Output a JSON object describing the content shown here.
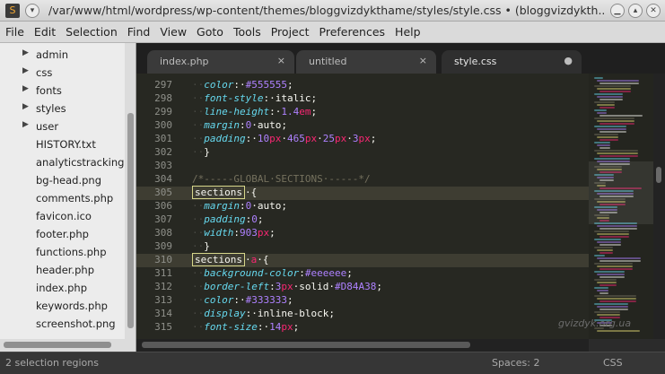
{
  "window": {
    "title": "/var/www/html/wordpress/wp-content/themes/bloggvizdykthame/styles/style.css • (bloggvizdykth..."
  },
  "menu": [
    "File",
    "Edit",
    "Selection",
    "Find",
    "View",
    "Goto",
    "Tools",
    "Project",
    "Preferences",
    "Help"
  ],
  "sidebar": {
    "items": [
      {
        "label": "admin",
        "folder": true
      },
      {
        "label": "css",
        "folder": true
      },
      {
        "label": "fonts",
        "folder": true
      },
      {
        "label": "styles",
        "folder": true
      },
      {
        "label": "user",
        "folder": true
      },
      {
        "label": "HISTORY.txt",
        "folder": false
      },
      {
        "label": "analyticstracking",
        "folder": false
      },
      {
        "label": "bg-head.png",
        "folder": false
      },
      {
        "label": "comments.php",
        "folder": false
      },
      {
        "label": "favicon.ico",
        "folder": false
      },
      {
        "label": "footer.php",
        "folder": false
      },
      {
        "label": "functions.php",
        "folder": false
      },
      {
        "label": "header.php",
        "folder": false
      },
      {
        "label": "index.php",
        "folder": false
      },
      {
        "label": "keywords.php",
        "folder": false
      },
      {
        "label": "screenshot.png",
        "folder": false
      }
    ]
  },
  "tabs": [
    {
      "label": "index.php",
      "close": "×",
      "active": false
    },
    {
      "label": "untitled",
      "close": "×",
      "active": false
    },
    {
      "label": "style.css",
      "close": "●",
      "active": true
    }
  ],
  "editor": {
    "highlight_lines": [
      "305",
      "310"
    ],
    "lines": [
      {
        "num": "297",
        "segs": [
          [
            "ws",
            "··"
          ],
          [
            "prop",
            "color"
          ],
          [
            "plain",
            ":·"
          ],
          [
            "val",
            "#555555"
          ],
          [
            "plain",
            ";"
          ]
        ]
      },
      {
        "num": "298",
        "segs": [
          [
            "ws",
            "··"
          ],
          [
            "prop",
            "font-style"
          ],
          [
            "plain",
            ":·italic;"
          ]
        ]
      },
      {
        "num": "299",
        "segs": [
          [
            "ws",
            "··"
          ],
          [
            "prop",
            "line-height"
          ],
          [
            "plain",
            ":·"
          ],
          [
            "val",
            "1.4"
          ],
          [
            "unit",
            "em"
          ],
          [
            "plain",
            ";"
          ]
        ]
      },
      {
        "num": "300",
        "segs": [
          [
            "ws",
            "··"
          ],
          [
            "prop",
            "margin"
          ],
          [
            "plain",
            ":"
          ],
          [
            "val",
            "0"
          ],
          [
            "plain",
            "·auto;"
          ]
        ]
      },
      {
        "num": "301",
        "segs": [
          [
            "ws",
            "··"
          ],
          [
            "prop",
            "padding"
          ],
          [
            "plain",
            ":·"
          ],
          [
            "val",
            "10"
          ],
          [
            "unit",
            "px"
          ],
          [
            "plain",
            "·"
          ],
          [
            "val",
            "465"
          ],
          [
            "unit",
            "px"
          ],
          [
            "plain",
            "·"
          ],
          [
            "val",
            "25"
          ],
          [
            "unit",
            "px"
          ],
          [
            "plain",
            "·"
          ],
          [
            "val",
            "3"
          ],
          [
            "unit",
            "px"
          ],
          [
            "plain",
            ";"
          ]
        ]
      },
      {
        "num": "302",
        "segs": [
          [
            "ws",
            "··"
          ],
          [
            "plain",
            "}"
          ]
        ]
      },
      {
        "num": "303",
        "segs": []
      },
      {
        "num": "304",
        "segs": [
          [
            "cmt",
            "/*-----GLOBAL·SECTIONS·-----*/"
          ]
        ]
      },
      {
        "num": "305",
        "segs": [
          [
            "sel",
            "sections"
          ],
          [
            "plain",
            "·{"
          ]
        ]
      },
      {
        "num": "306",
        "segs": [
          [
            "ws",
            "··"
          ],
          [
            "prop",
            "margin"
          ],
          [
            "plain",
            ":"
          ],
          [
            "val",
            "0"
          ],
          [
            "plain",
            "·auto;"
          ]
        ]
      },
      {
        "num": "307",
        "segs": [
          [
            "ws",
            "··"
          ],
          [
            "prop",
            "padding"
          ],
          [
            "plain",
            ":"
          ],
          [
            "val",
            "0"
          ],
          [
            "plain",
            ";"
          ]
        ]
      },
      {
        "num": "308",
        "segs": [
          [
            "ws",
            "··"
          ],
          [
            "prop",
            "width"
          ],
          [
            "plain",
            ":"
          ],
          [
            "val",
            "903"
          ],
          [
            "unit",
            "px"
          ],
          [
            "plain",
            ";"
          ]
        ]
      },
      {
        "num": "309",
        "segs": [
          [
            "ws",
            "··"
          ],
          [
            "plain",
            "}"
          ]
        ]
      },
      {
        "num": "310",
        "segs": [
          [
            "sel",
            "sections"
          ],
          [
            "plain",
            "·"
          ],
          [
            "unit",
            "a"
          ],
          [
            "plain",
            "·{"
          ]
        ]
      },
      {
        "num": "311",
        "segs": [
          [
            "ws",
            "··"
          ],
          [
            "prop",
            "background-color"
          ],
          [
            "plain",
            ":"
          ],
          [
            "val",
            "#eeeeee"
          ],
          [
            "plain",
            ";"
          ]
        ]
      },
      {
        "num": "312",
        "segs": [
          [
            "ws",
            "··"
          ],
          [
            "prop",
            "border-left"
          ],
          [
            "plain",
            ":"
          ],
          [
            "val",
            "3"
          ],
          [
            "unit",
            "px"
          ],
          [
            "plain",
            "·solid·"
          ],
          [
            "val",
            "#D84A38"
          ],
          [
            "plain",
            ";"
          ]
        ]
      },
      {
        "num": "313",
        "segs": [
          [
            "ws",
            "··"
          ],
          [
            "prop",
            "color"
          ],
          [
            "plain",
            ":·"
          ],
          [
            "val",
            "#333333"
          ],
          [
            "plain",
            ";"
          ]
        ]
      },
      {
        "num": "314",
        "segs": [
          [
            "ws",
            "··"
          ],
          [
            "prop",
            "display"
          ],
          [
            "plain",
            ":·inline-block;"
          ]
        ]
      },
      {
        "num": "315",
        "segs": [
          [
            "ws",
            "··"
          ],
          [
            "prop",
            "font-size"
          ],
          [
            "plain",
            ":·"
          ],
          [
            "val",
            "14"
          ],
          [
            "unit",
            "px"
          ],
          [
            "plain",
            ";"
          ]
        ]
      }
    ]
  },
  "watermark": "gvizdyk.org.ua",
  "statusbar": {
    "left": "2 selection regions",
    "spaces": "Spaces: 2",
    "syntax": "CSS"
  },
  "colors": {
    "editor_bg": "#272822",
    "gutter": "#8f908a",
    "property": "#66d9ef",
    "number": "#ae81ff",
    "unit": "#f92672",
    "comment": "#75715e",
    "selection_outline": "#d6d68a"
  }
}
